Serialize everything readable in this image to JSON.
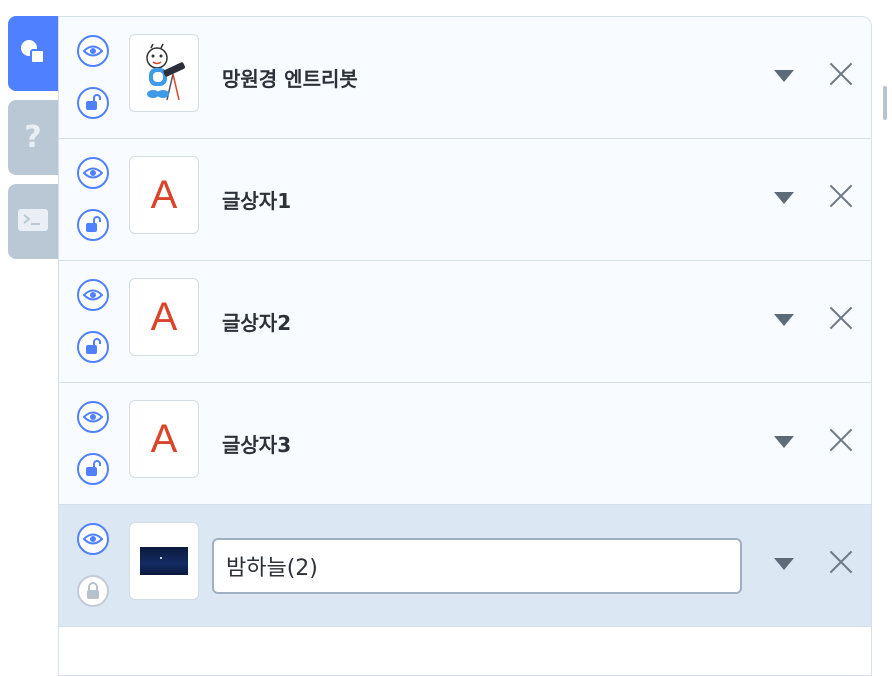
{
  "tabs": [
    {
      "icon": "objects-icon",
      "active": true
    },
    {
      "icon": "help-icon",
      "glyph": "?",
      "active": false
    },
    {
      "icon": "console-icon",
      "active": false
    }
  ],
  "objects": [
    {
      "name": "망원경 엔트리봇",
      "thumbnail": "entrybot-telescope",
      "visible": true,
      "locked": false,
      "selected": false
    },
    {
      "name": "글상자1",
      "thumbnail": "text-box",
      "thumbnail_text": "A",
      "visible": true,
      "locked": false,
      "selected": false
    },
    {
      "name": "글상자2",
      "thumbnail": "text-box",
      "thumbnail_text": "A",
      "visible": true,
      "locked": false,
      "selected": false
    },
    {
      "name": "글상자3",
      "thumbnail": "text-box",
      "thumbnail_text": "A",
      "visible": true,
      "locked": false,
      "selected": false
    },
    {
      "name": "밤하늘(2)",
      "thumbnail": "night-sky",
      "visible": true,
      "locked": true,
      "selected": true,
      "editing": true
    }
  ],
  "colors": {
    "accent": "#4f80ff",
    "text_box_letter": "#d9442a",
    "selected_row": "#dbe7f2"
  }
}
